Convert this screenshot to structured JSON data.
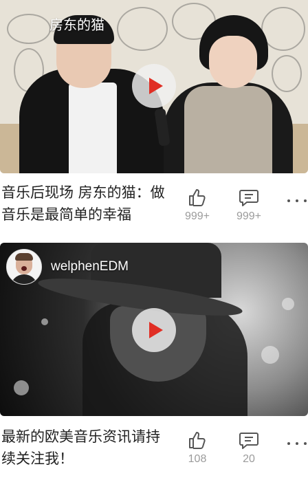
{
  "feed": [
    {
      "overlay_title": "房东的猫",
      "title": "音乐后现场 房东的猫：做音乐是最简单的幸福",
      "likes": "999+",
      "comments": "999+"
    },
    {
      "channel_name": "welphenEDM",
      "title": "最新的欧美音乐资讯请持续关注我！",
      "likes": "108",
      "comments": "20"
    }
  ],
  "icons": {
    "play": "play-icon",
    "like": "thumbs-up-icon",
    "comment": "comment-icon",
    "more": "more-dots-icon"
  },
  "colors": {
    "play_triangle": "#e02e24",
    "title_text": "#222222",
    "stat_text": "#9b9b9b"
  }
}
